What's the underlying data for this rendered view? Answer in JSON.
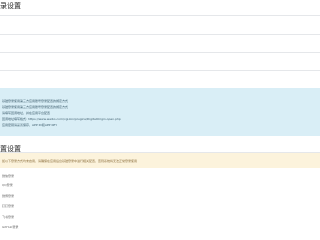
{
  "section1": {
    "title": "录设置",
    "rows": [
      "",
      "",
      "",
      "",
      ""
    ]
  },
  "info": {
    "heading": "",
    "lines": [
      "基础登录使用第三方应用账号登录配置的绑定方式",
      "基础登录使用第三方应用账号登录配置的绑定方式",
      "请填写回调地址，并在应用平台配置",
      "回调地址填写格式: https://www.weibo.com/cgi-bin/plugins/DigitalOrigin.open.php",
      "应用密钥请妥善保存，APP ID和APP KEY"
    ]
  },
  "section2": {
    "title": "置设置",
    "warning": "如以下登录方式均未启用，请确保在应用后台基础登录中进行相关配置，否则系统将无法正常登录使用"
  },
  "list": {
    "items": [
      "微信登录",
      "QQ登录",
      "微博登录",
      "钉钉登录",
      "飞书登录",
      "GitHub登录"
    ]
  }
}
